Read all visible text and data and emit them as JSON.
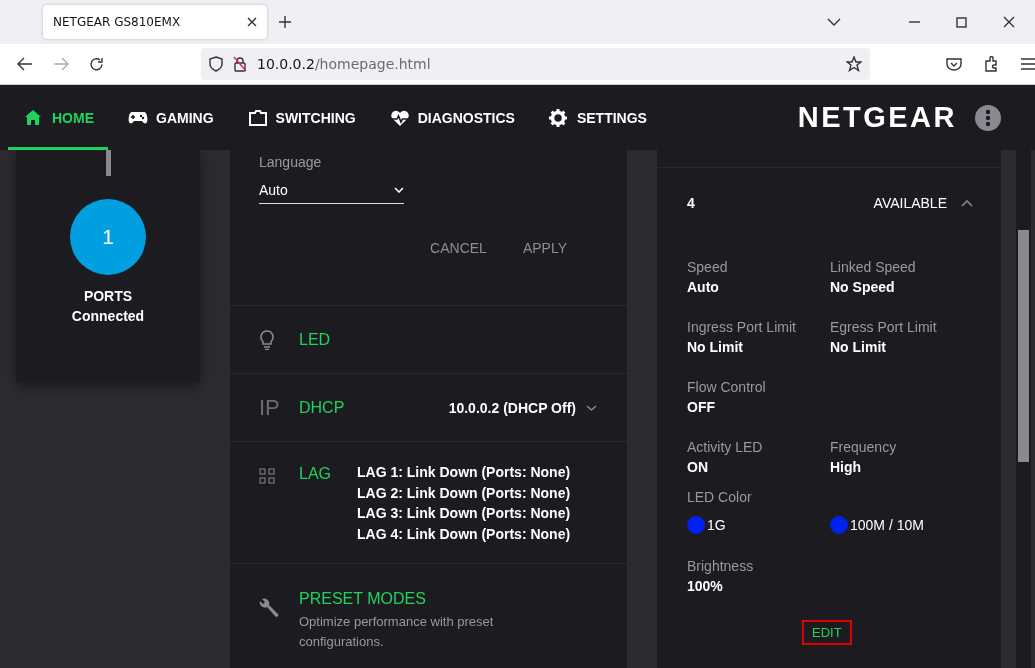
{
  "browser": {
    "tab_title": "NETGEAR GS810EMX",
    "url_host": "10.0.0.2",
    "url_path": "/homepage.html"
  },
  "nav": {
    "items": [
      {
        "label": "HOME",
        "selected": true
      },
      {
        "label": "GAMING",
        "selected": false
      },
      {
        "label": "SWITCHING",
        "selected": false
      },
      {
        "label": "DIAGNOSTICS",
        "selected": false
      },
      {
        "label": "SETTINGS",
        "selected": false
      }
    ],
    "logo": "NETGEAR"
  },
  "ports_card": {
    "count": "1",
    "label": "PORTS",
    "status": "Connected"
  },
  "settings": {
    "language": {
      "label": "Language",
      "value": "Auto"
    },
    "buttons": [
      "CANCEL",
      "APPLY"
    ],
    "rows": [
      {
        "kind": "simple",
        "title": "LED"
      },
      {
        "kind": "value",
        "icon_text": "IP",
        "title": "DHCP",
        "value": "10.0.0.2 (DHCP Off)"
      },
      {
        "kind": "list",
        "title": "LAG",
        "lines": [
          "LAG 1: Link Down (Ports: None)",
          "LAG 2: Link Down (Ports: None)",
          "LAG 3: Link Down (Ports: None)",
          "LAG 4: Link Down (Ports: None)"
        ]
      },
      {
        "kind": "description",
        "title": "PRESET MODES",
        "description": "Optimize performance with preset configurations."
      }
    ]
  },
  "port": {
    "number": "4",
    "status": "AVAILABLE",
    "expanded": true,
    "field_rows": [
      [
        {
          "label": "Speed",
          "value": "Auto"
        },
        {
          "label": "Linked Speed",
          "value": "No Speed"
        }
      ],
      [
        {
          "label": "Ingress Port Limit",
          "value": "No Limit"
        },
        {
          "label": "Egress Port Limit",
          "value": "No Limit"
        }
      ],
      [
        {
          "label": "Flow Control",
          "value": "OFF"
        }
      ],
      [
        {
          "label": "Activity LED",
          "value": "ON"
        },
        {
          "label": "Frequency",
          "value": "High"
        }
      ]
    ],
    "led_color": {
      "label": "LED Color",
      "options": [
        {
          "label": "1G",
          "color": "#0022ee"
        },
        {
          "label": "100M / 10M",
          "color": "#0022ee"
        }
      ]
    },
    "brightness": {
      "label": "Brightness",
      "value": "100%"
    },
    "edit": {
      "label": "EDIT",
      "highlighted": true
    }
  }
}
